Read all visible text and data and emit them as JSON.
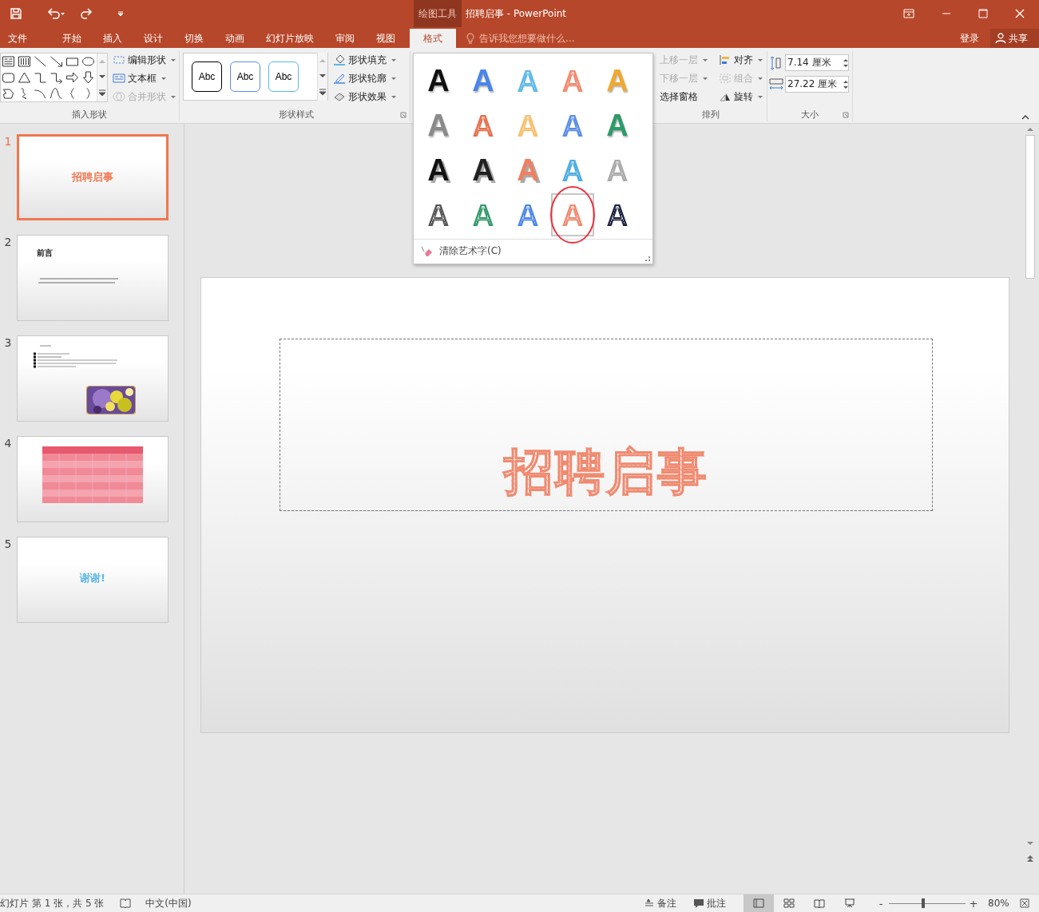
{
  "title_bar": {
    "context_group": "绘图工具",
    "title": "招聘启事 - PowerPoint"
  },
  "ribbon_tabs": [
    {
      "label": "文件",
      "selected": false
    },
    {
      "label": "开始",
      "selected": false
    },
    {
      "label": "插入",
      "selected": false
    },
    {
      "label": "设计",
      "selected": false
    },
    {
      "label": "切换",
      "selected": false
    },
    {
      "label": "动画",
      "selected": false
    },
    {
      "label": "幻灯片放映",
      "selected": false
    },
    {
      "label": "审阅",
      "selected": false
    },
    {
      "label": "视图",
      "selected": false
    },
    {
      "label": "格式",
      "selected": true
    }
  ],
  "tell_me": {
    "placeholder": "告诉我您想要做什么..."
  },
  "account": {
    "sign_in": "登录",
    "share": "共享"
  },
  "insert_shapes": {
    "commands": [
      {
        "label": "编辑形状",
        "disabled": false
      },
      {
        "label": "文本框",
        "disabled": false
      },
      {
        "label": "合并形状",
        "disabled": true
      }
    ],
    "label": "插入形状"
  },
  "shape_styles": {
    "samples": [
      {
        "text": "Abc",
        "color": "#000000"
      },
      {
        "text": "Abc",
        "color": "#5b8ee8"
      },
      {
        "text": "Abc",
        "color": "#5bb8e8"
      }
    ],
    "commands": [
      {
        "label": "形状填充",
        "disabled": false
      },
      {
        "label": "形状轮廓",
        "disabled": false
      },
      {
        "label": "形状效果",
        "disabled": false
      }
    ],
    "label": "形状样式"
  },
  "wordart_gallery": {
    "styles": [
      {
        "glyph": "A",
        "kind": "solid",
        "color": "#111111",
        "selected": false,
        "circled": false
      },
      {
        "glyph": "A",
        "kind": "solid",
        "color": "#4a86e8",
        "selected": false,
        "circled": false
      },
      {
        "glyph": "A",
        "kind": "outline",
        "color": "#5bb8e8",
        "selected": false,
        "circled": false
      },
      {
        "glyph": "A",
        "kind": "outline",
        "color": "#f08a70",
        "selected": false,
        "circled": false
      },
      {
        "glyph": "A",
        "kind": "solid",
        "color": "#f0a830",
        "selected": false,
        "circled": false
      },
      {
        "glyph": "A",
        "kind": "solid",
        "color": "#8a8a8a",
        "selected": false,
        "circled": false
      },
      {
        "glyph": "A",
        "kind": "outline",
        "color": "#e8704e",
        "selected": false,
        "circled": false
      },
      {
        "glyph": "A",
        "kind": "outline",
        "color": "#f8c070",
        "selected": false,
        "circled": false
      },
      {
        "glyph": "A",
        "kind": "outline",
        "color": "#5b8ee8",
        "selected": false,
        "circled": false
      },
      {
        "glyph": "A",
        "kind": "solid",
        "color": "#2e9a6a",
        "selected": false,
        "circled": false
      },
      {
        "glyph": "A",
        "kind": "shadow",
        "color": "#111111",
        "selected": false,
        "circled": false
      },
      {
        "glyph": "A",
        "kind": "shadow",
        "color": "#222222",
        "selected": false,
        "circled": false
      },
      {
        "glyph": "A",
        "kind": "shadow",
        "color": "#f08060",
        "selected": false,
        "circled": false
      },
      {
        "glyph": "A",
        "kind": "outline",
        "color": "#4aaee0",
        "selected": false,
        "circled": false
      },
      {
        "glyph": "A",
        "kind": "outline",
        "color": "#aaaaaa",
        "selected": false,
        "circled": false
      },
      {
        "glyph": "A",
        "kind": "striped",
        "color": "#555555",
        "selected": false,
        "circled": false
      },
      {
        "glyph": "A",
        "kind": "striped",
        "color": "#2e9a6a",
        "selected": false,
        "circled": false
      },
      {
        "glyph": "A",
        "kind": "striped",
        "color": "#4a86e8",
        "selected": false,
        "circled": false
      },
      {
        "glyph": "A",
        "kind": "striped",
        "color": "#f08a70",
        "selected": true,
        "circled": true
      },
      {
        "glyph": "A",
        "kind": "striped",
        "color": "#1a2440",
        "selected": false,
        "circled": false
      }
    ],
    "clear": "清除艺术字(C)"
  },
  "arrange": {
    "commands": [
      {
        "label": "上移一层",
        "disabled": true
      },
      {
        "label": "下移一层",
        "disabled": true
      },
      {
        "label": "选择窗格",
        "disabled": false
      },
      {
        "label": "对齐",
        "disabled": false
      },
      {
        "label": "组合",
        "disabled": true
      },
      {
        "label": "旋转",
        "disabled": false
      }
    ],
    "label": "排列"
  },
  "size": {
    "height": "7.14 厘米",
    "width": "27.22 厘米",
    "label": "大小"
  },
  "slides": [
    {
      "number": "1",
      "selected": true,
      "kind": "title",
      "title": "招聘启事",
      "color": "#f07850"
    },
    {
      "number": "2",
      "selected": false,
      "kind": "text",
      "title": "前言",
      "color": "#111111"
    },
    {
      "number": "3",
      "selected": false,
      "kind": "bullets"
    },
    {
      "number": "4",
      "selected": false,
      "kind": "table"
    },
    {
      "number": "5",
      "selected": false,
      "kind": "title",
      "title": "谢谢!",
      "color": "#5bb8e8"
    }
  ],
  "slide": {
    "title": "招聘启事"
  },
  "status_bar": {
    "slide_info": "幻灯片 第 1 张，共 5 张",
    "language": "中文(中国)",
    "notes": "备注",
    "comments": "批注",
    "views": [
      {
        "kind": "normal",
        "selected": true
      },
      {
        "kind": "sorter",
        "selected": false
      },
      {
        "kind": "reading",
        "selected": false
      },
      {
        "kind": "slideshow",
        "selected": false
      }
    ],
    "zoom_out": "-",
    "zoom": {
      "level": 0.45
    },
    "zoom_in": "+",
    "zoom_percent": "80%"
  }
}
